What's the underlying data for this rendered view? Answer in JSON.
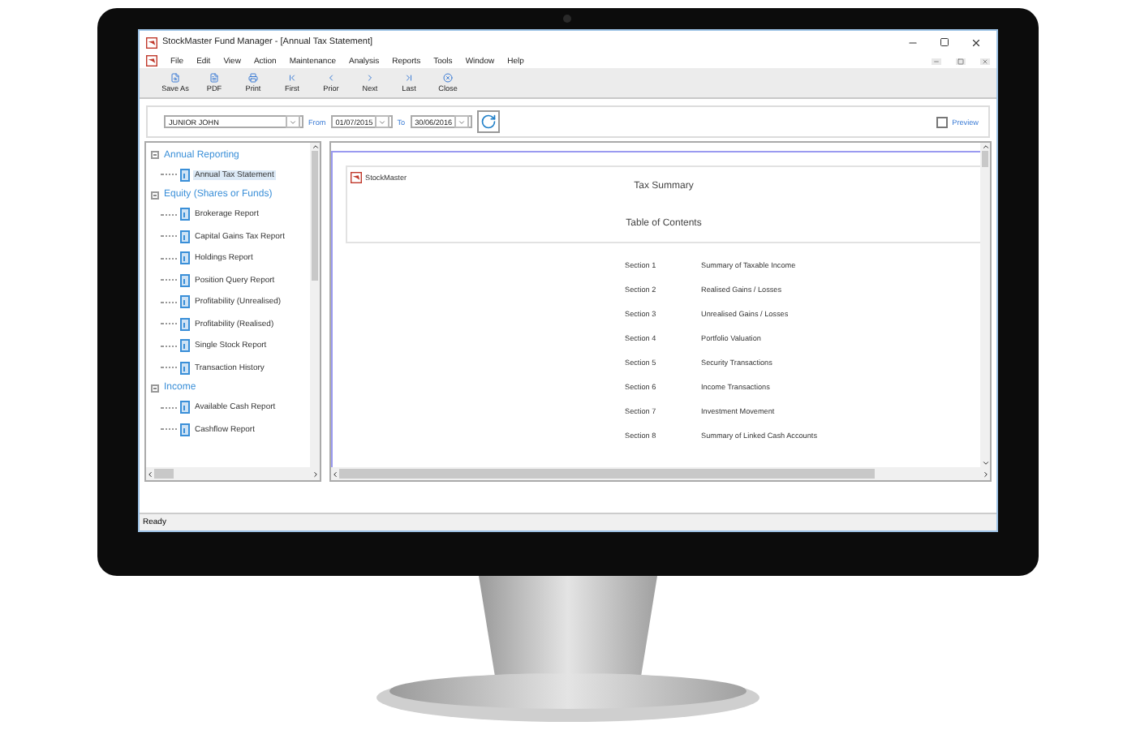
{
  "window": {
    "title": "StockMaster Fund Manager - [Annual Tax Statement]"
  },
  "menu": [
    "File",
    "Edit",
    "View",
    "Action",
    "Maintenance",
    "Analysis",
    "Reports",
    "Tools",
    "Window",
    "Help"
  ],
  "toolbar": [
    {
      "label": "Save As",
      "kind": "save"
    },
    {
      "label": "PDF",
      "kind": "pdf"
    },
    {
      "label": "Print",
      "kind": "print"
    },
    {
      "label": "First",
      "kind": "first"
    },
    {
      "label": "Prior",
      "kind": "prior"
    },
    {
      "label": "Next",
      "kind": "next"
    },
    {
      "label": "Last",
      "kind": "last"
    },
    {
      "label": "Close",
      "kind": "close"
    }
  ],
  "filter": {
    "account": "JUNIOR JOHN",
    "from_label": "From",
    "from_date": "01/07/2015",
    "to_label": "To",
    "to_date": "30/06/2016",
    "preview": {
      "label": "Preview",
      "checked": false
    }
  },
  "tree": [
    {
      "label": "Annual Reporting",
      "expanded": true,
      "children": [
        {
          "label": "Annual Tax Statement",
          "selected": true
        }
      ]
    },
    {
      "label": "Equity (Shares or Funds)",
      "expanded": true,
      "children": [
        {
          "label": "Brokerage Report",
          "selected": false
        },
        {
          "label": "Capital Gains Tax Report",
          "selected": false
        },
        {
          "label": "Holdings Report",
          "selected": false
        },
        {
          "label": "Position Query Report",
          "selected": false
        },
        {
          "label": "Profitability (Unrealised)",
          "selected": false
        },
        {
          "label": "Profitability (Realised)",
          "selected": false
        },
        {
          "label": "Single Stock Report",
          "selected": false
        },
        {
          "label": "Transaction History",
          "selected": false
        }
      ]
    },
    {
      "label": "Income",
      "expanded": true,
      "children": [
        {
          "label": "Available Cash Report",
          "selected": false
        },
        {
          "label": "Cashflow Report",
          "selected": false
        }
      ]
    }
  ],
  "report": {
    "brand": "StockMaster",
    "title": "Tax Summary",
    "subtitle": "Table of Contents",
    "sections": [
      {
        "number": "Section 1",
        "name": "Summary of Taxable Income"
      },
      {
        "number": "Section 2",
        "name": "Realised Gains / Losses"
      },
      {
        "number": "Section 3",
        "name": "Unrealised Gains / Losses"
      },
      {
        "number": "Section 4",
        "name": "Portfolio Valuation"
      },
      {
        "number": "Section 5",
        "name": "Security Transactions"
      },
      {
        "number": "Section 6",
        "name": "Income Transactions"
      },
      {
        "number": "Section 7",
        "name": "Investment Movement"
      },
      {
        "number": "Section 8",
        "name": "Summary of Linked Cash Accounts"
      }
    ]
  },
  "status_bar": "Ready"
}
